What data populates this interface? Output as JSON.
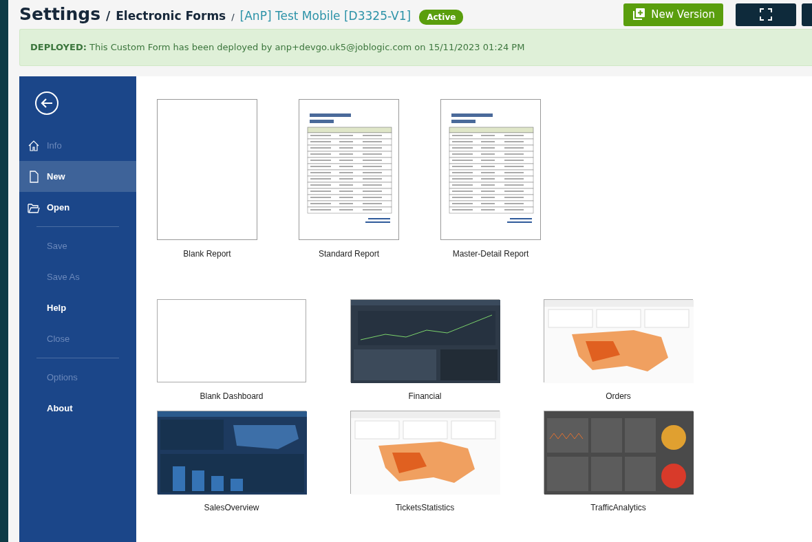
{
  "header": {
    "title": "Settings",
    "breadcrumbs": [
      {
        "separator": "/",
        "label": "Electronic Forms",
        "kind": "section"
      },
      {
        "separator": "/",
        "label": "[AnP] Test Mobile [D3325-V1]",
        "kind": "link"
      }
    ],
    "status_badge": "Active",
    "buttons": [
      {
        "label": "New Version",
        "kind": "primary"
      },
      {
        "kind": "fullscreen"
      },
      {
        "kind": "partial"
      }
    ]
  },
  "alert": {
    "label": "DEPLOYED:",
    "message": "This Custom Form has been deployed by anp+devgo.uk5@joblogic.com on 15/11/2023 01:24 PM"
  },
  "sidebar": {
    "groups": [
      [
        {
          "label": "Info",
          "selected": false,
          "disabled": true
        },
        {
          "label": "New",
          "selected": true,
          "disabled": false
        },
        {
          "label": "Open",
          "selected": false,
          "disabled": false
        }
      ],
      [
        {
          "label": "Save",
          "selected": false,
          "disabled": true
        },
        {
          "label": "Save As",
          "selected": false,
          "disabled": true
        },
        {
          "label": "Help",
          "selected": false,
          "disabled": false
        },
        {
          "label": "Close",
          "selected": false,
          "disabled": true
        }
      ],
      [
        {
          "label": "Options",
          "selected": false,
          "disabled": true
        },
        {
          "label": "About",
          "selected": false,
          "disabled": false
        }
      ]
    ]
  },
  "templates": [
    {
      "label": "Blank Report",
      "kind": "blank-report"
    },
    {
      "label": "Standard Report",
      "kind": "report"
    },
    {
      "label": "Master-Detail Report",
      "kind": "report"
    }
  ],
  "dashboards": [
    {
      "label": "Blank Dashboard",
      "kind": "blank"
    },
    {
      "label": "Financial",
      "kind": "dark"
    },
    {
      "label": "Orders",
      "kind": "light"
    },
    {
      "label": "SalesOverview",
      "kind": "navy"
    },
    {
      "label": "TicketsStatistics",
      "kind": "light"
    },
    {
      "label": "TrafficAnalytics",
      "kind": "gray"
    }
  ]
}
